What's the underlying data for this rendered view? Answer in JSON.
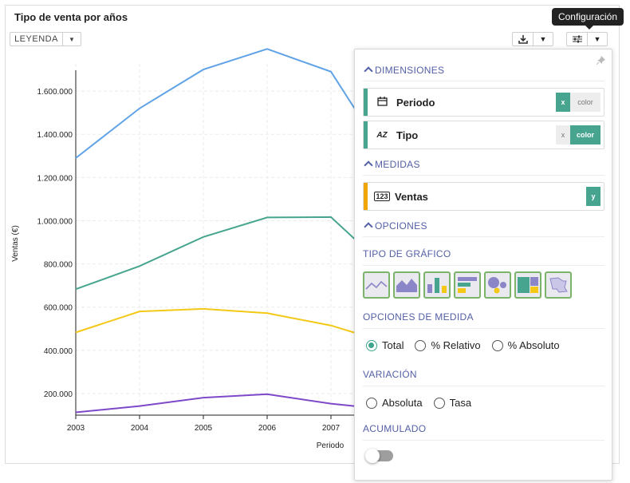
{
  "title": "Tipo de venta por años",
  "legend_label": "LEYENDA",
  "tooltip": "Configuración",
  "colors": {
    "series1": "#5fa3e6",
    "series2": "#47a58f",
    "series3": "#f4c816",
    "series4": "#7e49c8",
    "accent": "#3ea58c",
    "dim_bar": "#47a58f",
    "measure_bar": "#f0a500"
  },
  "chart_data": {
    "type": "line",
    "x": [
      "2003",
      "2004",
      "2005",
      "2006",
      "2007"
    ],
    "ylabel": "Ventas (€)",
    "xlabel": "Periodo",
    "yticks": [
      "200.000",
      "400.000",
      "600.000",
      "800.000",
      "1.000.000",
      "1.200.000",
      "1.400.000",
      "1.600.000"
    ],
    "ylim": [
      100000,
      1800000
    ],
    "series": [
      {
        "values": [
          1290000,
          1520000,
          1700000,
          1795000,
          1690000
        ],
        "tail": 1460000,
        "color": "#5fa3e6"
      },
      {
        "values": [
          683000,
          790000,
          925000,
          1015000,
          1017000
        ],
        "tail": 880000,
        "color": "#47a58f"
      },
      {
        "values": [
          483000,
          580000,
          592000,
          572000,
          515000
        ],
        "tail": 470000,
        "color": "#f4c816"
      },
      {
        "values": [
          113000,
          142000,
          181000,
          197000,
          153000
        ],
        "tail": 138000,
        "color": "#7e49c8"
      }
    ]
  },
  "panel": {
    "dimensions_label": "DIMENSIONES",
    "fields": [
      {
        "name": "Periodo",
        "icon": "📅",
        "tag1": "x",
        "tag2": "color"
      },
      {
        "name": "Tipo",
        "icon": "AZ",
        "tag1": "x",
        "tag2": "color"
      }
    ],
    "measures_label": "MEDIDAS",
    "measure": {
      "name": "Ventas",
      "icon": "123",
      "tag": "y"
    },
    "options_label": "OPCIONES",
    "chart_type_label": "TIPO DE GRÁFICO",
    "chart_types": [
      "line-chart-icon",
      "area-chart-icon",
      "bar-chart-icon",
      "hbar-chart-icon",
      "bubble-chart-icon",
      "treemap-icon",
      "map-icon"
    ],
    "measure_options_label": "OPCIONES DE MEDIDA",
    "measure_options": [
      "Total",
      "% Relativo",
      "% Absoluto"
    ],
    "variation_label": "VARIACIÓN",
    "variation_options": [
      "Absoluta",
      "Tasa"
    ],
    "accumulated_label": "ACUMULADO"
  }
}
